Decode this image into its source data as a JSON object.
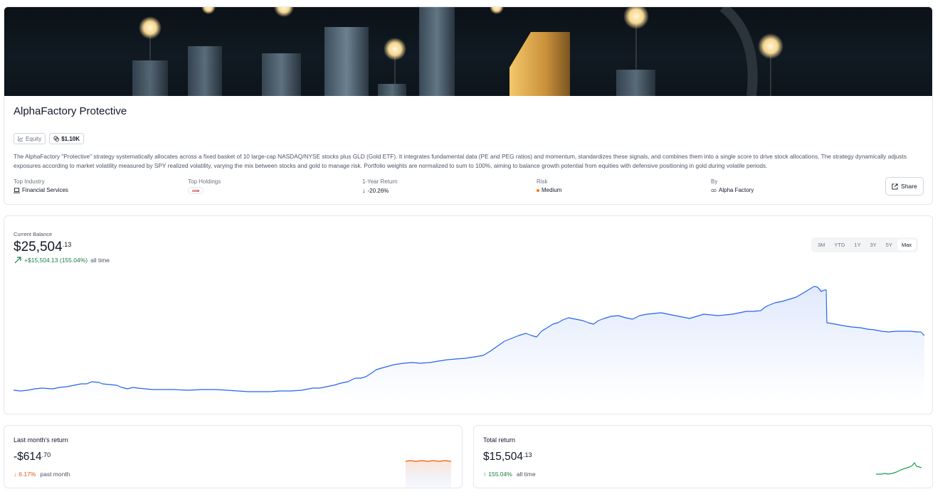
{
  "strategy": {
    "title": "AlphaFactory Protective",
    "badges": {
      "category": "Equity",
      "min_investment": "$1.10K"
    },
    "description": "The AlphaFactory \"Protective\" strategy systematically allocates across a fixed basket of 10 large-cap NASDAQ/NYSE stocks plus GLD (Gold ETF). It integrates fundamental data (PE and PEG ratios) and momentum, standardizes these signals, and combines them into a single score to drive stock allocations. The strategy dynamically adjusts exposures according to market volatility measured by SPY realized volatility, varying the mix between stocks and gold to manage risk. Portfolio weights are normalized to sum to 100%, aiming to balance growth potential from equities with defensive positioning in gold during volatile periods.",
    "meta": {
      "industry_label": "Top Industry",
      "industry_value": "Financial Services",
      "holdings_label": "Top Holdings",
      "holding_ticker": "XOM",
      "return_label": "1-Year Return",
      "return_value": "-20.26%",
      "risk_label": "Risk",
      "risk_value": "Medium",
      "by_label": "By",
      "by_value": "Alpha Factory"
    },
    "share_label": "Share"
  },
  "balance": {
    "label": "Current Balance",
    "value_main": "$25,504",
    "value_cents": ".13",
    "change": "+$15,504.13 (155.04%)",
    "change_suffix": "all time",
    "ranges": [
      "3M",
      "YTD",
      "1Y",
      "3Y",
      "5Y",
      "Max"
    ],
    "active_range": "Max"
  },
  "last_month": {
    "label": "Last month's return",
    "value_main": "-$614",
    "value_cents": ".70",
    "change": "6.17%",
    "change_suffix": "past month"
  },
  "total_return": {
    "label": "Total return",
    "value_main": "$15,504",
    "value_cents": ".13",
    "change": "155.04%",
    "change_suffix": "all time"
  },
  "colors": {
    "line_blue": "#2563eb",
    "positive": "#15803d",
    "negative": "#ea580c",
    "risk_dot": "#f97316"
  },
  "icons": [
    "chart-icon",
    "coins-icon",
    "laptop-icon",
    "arrow-down-icon",
    "dot-icon",
    "link-icon",
    "share-icon",
    "trend-up-icon",
    "arrow-up-icon"
  ]
}
